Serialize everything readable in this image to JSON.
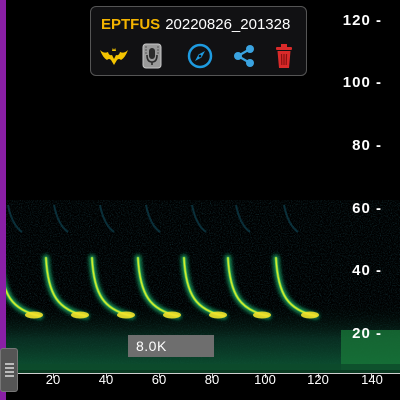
{
  "recording": {
    "species_code": "EPTFUS",
    "file_name": "20220826_201328"
  },
  "toolbar": {
    "icons": [
      "bat-icon",
      "microphone-icon",
      "compass-icon",
      "share-icon",
      "trash-icon"
    ]
  },
  "zoom_label": "8.0K",
  "frequency_axis": {
    "ticks": [
      "120",
      "100",
      "80",
      "60",
      "40",
      "20"
    ]
  },
  "time_axis": {
    "ticks": [
      "20",
      "40",
      "60",
      "80",
      "100",
      "120",
      "140"
    ]
  },
  "colors": {
    "species_code": "#f4b400",
    "edge_bar": "#8a1fa6",
    "compass": "#1e9be0",
    "share": "#3aa3e0",
    "trash": "#d92a2a"
  }
}
